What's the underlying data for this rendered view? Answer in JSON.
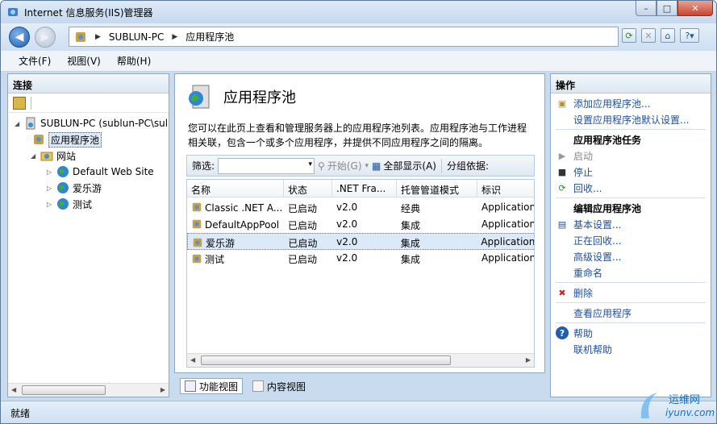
{
  "window": {
    "title": "Internet 信息服务(IIS)管理器",
    "buttons": {
      "minimize": "–",
      "maximize": "□",
      "close": "✕"
    }
  },
  "address": {
    "segments": [
      "SUBLUN-PC",
      "应用程序池"
    ]
  },
  "menu": [
    "文件(F)",
    "视图(V)",
    "帮助(H)"
  ],
  "connections": {
    "header": "连接",
    "tree": [
      {
        "label": "SUBLUN-PC (sublun-PC\\sul",
        "icon": "server-icon",
        "level": 0,
        "expanded": true
      },
      {
        "label": "应用程序池",
        "icon": "app-pool-icon",
        "level": 1,
        "selected": true
      },
      {
        "label": "网站",
        "icon": "sites-folder-icon",
        "level": 1,
        "expanded": true
      },
      {
        "label": "Default Web Site",
        "icon": "globe-icon",
        "level": 2
      },
      {
        "label": "爱乐游",
        "icon": "globe-icon",
        "level": 2
      },
      {
        "label": "测试",
        "icon": "globe-icon",
        "level": 2
      }
    ]
  },
  "center": {
    "title": "应用程序池",
    "description": "您可以在此页上查看和管理服务器上的应用程序池列表。应用程序池与工作进程相关联，包含一个或多个应用程序，并提供不同应用程序之间的隔离。",
    "filter": {
      "label": "筛选:",
      "start": "开始(G)",
      "show_all": "全部显示(A)",
      "group_by": "分组依据:"
    },
    "columns": [
      "名称",
      "状态",
      ".NET Fra...",
      "托管管道模式",
      "标识"
    ],
    "rows": [
      {
        "name": "Classic .NET A...",
        "status": "已启动",
        "net": "v2.0",
        "pipeline": "经典",
        "identity": "Application"
      },
      {
        "name": "DefaultAppPool",
        "status": "已启动",
        "net": "v2.0",
        "pipeline": "集成",
        "identity": "Application"
      },
      {
        "name": "爱乐游",
        "status": "已启动",
        "net": "v2.0",
        "pipeline": "集成",
        "identity": "Application"
      },
      {
        "name": "测试",
        "status": "已启动",
        "net": "v2.0",
        "pipeline": "集成",
        "identity": "Application"
      }
    ],
    "selected_row": 2
  },
  "view_tabs": [
    "功能视图",
    "内容视图"
  ],
  "actions": {
    "header": "操作",
    "items": [
      {
        "label": "添加应用程序池...",
        "type": "link",
        "icon": "add-pool-icon"
      },
      {
        "label": "设置应用程序池默认设置...",
        "type": "link",
        "icon": ""
      },
      {
        "label": "应用程序池任务",
        "type": "hdr",
        "icon": ""
      },
      {
        "label": "启动",
        "type": "dis",
        "icon": "play-icon"
      },
      {
        "label": "停止",
        "type": "link",
        "icon": "stop-icon"
      },
      {
        "label": "回收...",
        "type": "link",
        "icon": "recycle-icon"
      },
      {
        "label": "编辑应用程序池",
        "type": "hdr",
        "icon": ""
      },
      {
        "label": "基本设置...",
        "type": "link",
        "icon": "settings-icon"
      },
      {
        "label": "正在回收...",
        "type": "link",
        "icon": ""
      },
      {
        "label": "高级设置...",
        "type": "link",
        "icon": ""
      },
      {
        "label": "重命名",
        "type": "link",
        "icon": ""
      },
      {
        "label": "删除",
        "type": "link",
        "icon": "delete-icon"
      },
      {
        "label": "查看应用程序",
        "type": "link",
        "icon": ""
      },
      {
        "label": "帮助",
        "type": "link",
        "icon": "help-icon"
      },
      {
        "label": "联机帮助",
        "type": "link",
        "icon": ""
      }
    ]
  },
  "status": "就绪",
  "watermark": {
    "line1": "运维网",
    "line2": "iyunv.com"
  },
  "colors": {
    "link": "#1c4f9c",
    "accent": "#1f5db2",
    "delete": "#c62828",
    "recycle": "#2e8b2e"
  }
}
